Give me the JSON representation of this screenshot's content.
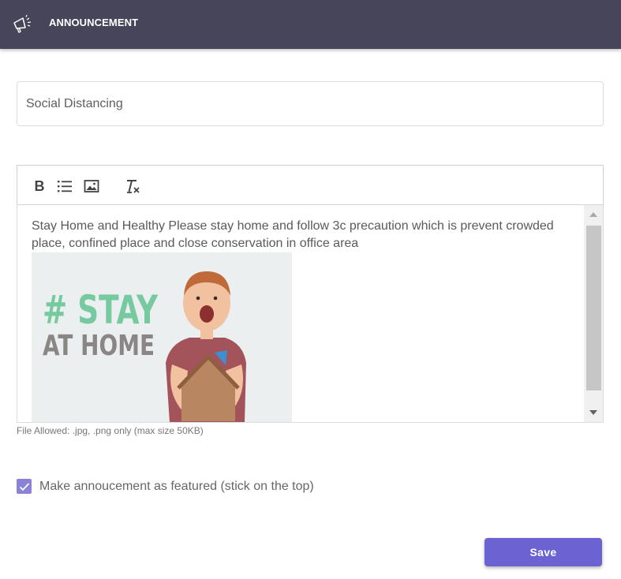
{
  "header": {
    "icon": "megaphone-icon",
    "title": "ANNOUNCEMENT",
    "background": "#474559"
  },
  "form": {
    "title_value": "Social Distancing",
    "toolbar": {
      "bold_label": "B",
      "icons": [
        "bold-icon",
        "bulleted-list-icon",
        "insert-image-icon",
        "clear-formatting-icon"
      ]
    },
    "editor": {
      "body_text": "Stay Home and Healthy Please stay home and follow 3c precaution which is prevent crowded place, confined place and close conservation in office area",
      "image": {
        "headline": "# STAY",
        "subline": "AT HOME"
      }
    },
    "file_hint": "File Allowed: .jpg, .png only (max size 50KB)",
    "featured": {
      "checked": true,
      "label": "Make annoucement as featured (stick on the top)"
    },
    "save_label": "Save"
  },
  "colors": {
    "accent": "#6b63d1",
    "checkbox": "#8a82d6",
    "image_green": "#77c9a0",
    "image_gray": "#8b8686"
  }
}
